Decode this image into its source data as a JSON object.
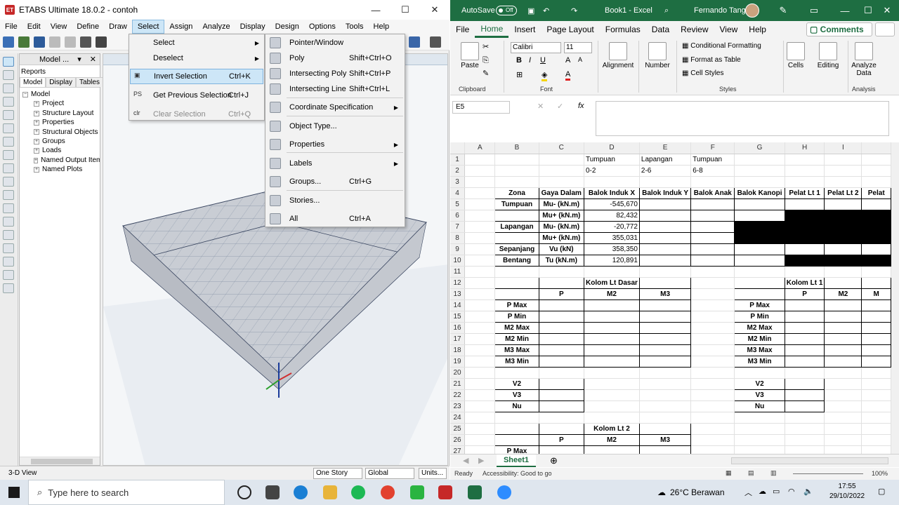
{
  "etabs": {
    "title": "ETABS Ultimate 18.0.2 - contoh",
    "app_badge": "ET",
    "menus": [
      "File",
      "Edit",
      "View",
      "Define",
      "Draw",
      "Select",
      "Assign",
      "Analyze",
      "Display",
      "Design",
      "Options",
      "Tools",
      "Help"
    ],
    "active_menu": "Select",
    "panel": {
      "title": "Model ...",
      "reports": "Reports",
      "tabs": [
        "Model",
        "Display",
        "Tables"
      ],
      "root": "Model",
      "items": [
        "Project",
        "Structure Layout",
        "Properties",
        "Structural Objects",
        "Groups",
        "Loads",
        "Named Output Items",
        "Named Plots"
      ]
    },
    "select_menu": [
      {
        "label": "Select",
        "shortcut": "",
        "submenu": true,
        "state": "normal",
        "icon": ""
      },
      {
        "label": "Deselect",
        "shortcut": "",
        "submenu": true,
        "state": "normal",
        "icon": ""
      },
      {
        "label": "Invert Selection",
        "shortcut": "Ctrl+K",
        "submenu": false,
        "state": "highlight",
        "icon": "invert-selection-icon"
      },
      {
        "label": "Get Previous Selection",
        "shortcut": "Ctrl+J",
        "submenu": false,
        "state": "normal",
        "icon": "PS"
      },
      {
        "label": "Clear Selection",
        "shortcut": "Ctrl+Q",
        "submenu": false,
        "state": "disabled",
        "icon": "clr"
      }
    ],
    "sub_menu": [
      {
        "label": "Pointer/Window",
        "shortcut": "",
        "submenu": false
      },
      {
        "label": "Poly",
        "shortcut": "Shift+Ctrl+O",
        "submenu": false
      },
      {
        "label": "Intersecting Poly",
        "shortcut": "Shift+Ctrl+P",
        "submenu": false
      },
      {
        "label": "Intersecting Line",
        "shortcut": "Shift+Ctrl+L",
        "submenu": false
      },
      {
        "label": "Coordinate Specification",
        "shortcut": "",
        "submenu": true
      },
      {
        "label": "Object Type...",
        "shortcut": "",
        "submenu": false
      },
      {
        "label": "Properties",
        "shortcut": "",
        "submenu": true
      },
      {
        "label": "Labels",
        "shortcut": "",
        "submenu": true
      },
      {
        "label": "Groups...",
        "shortcut": "Ctrl+G",
        "submenu": false
      },
      {
        "label": "Stories...",
        "shortcut": "",
        "submenu": false
      },
      {
        "label": "All",
        "shortcut": "Ctrl+A",
        "submenu": false
      }
    ],
    "status": {
      "view": "3-D View",
      "story": "One Story",
      "coord": "Global",
      "units": "Units..."
    }
  },
  "excel": {
    "autosave": "AutoSave",
    "autosave_state": "Off",
    "title": "Book1 - Excel",
    "user": "Fernando Tang",
    "tabs": [
      "File",
      "Home",
      "Insert",
      "Page Layout",
      "Formulas",
      "Data",
      "Review",
      "View",
      "Help"
    ],
    "active_tab": "Home",
    "comments": "Comments",
    "ribbon": {
      "paste": "Paste",
      "clipboard": "Clipboard",
      "font_name": "Calibri",
      "font_size": "11",
      "font": "Font",
      "alignment": "Alignment",
      "number": "Number",
      "cond_format": "Conditional Formatting",
      "format_table": "Format as Table",
      "cell_styles": "Cell Styles",
      "styles": "Styles",
      "cells": "Cells",
      "editing": "Editing",
      "analyze": "Analyze Data",
      "analysis": "Analysis"
    },
    "name_box": "E5",
    "fx": "fx",
    "columns": [
      "A",
      "B",
      "C",
      "D",
      "E",
      "F",
      "G",
      "H",
      "I",
      ""
    ],
    "rows": [
      [
        "",
        "",
        "",
        "Tumpuan",
        "Lapangan",
        "Tumpuan",
        "",
        "",
        "",
        ""
      ],
      [
        "",
        "",
        "",
        "0-2",
        "2-6",
        "6-8",
        "",
        "",
        "",
        ""
      ],
      [
        "",
        "",
        "",
        "",
        "",
        "",
        "",
        "",
        "",
        ""
      ],
      [
        "",
        "Zona",
        "Gaya Dalam",
        "Balok Induk X",
        "Balok Induk Y",
        "Balok Anak",
        "Balok Kanopi",
        "Pelat Lt 1",
        "Pelat Lt 2",
        "Pelat"
      ],
      [
        "",
        "Tumpuan",
        "Mu- (kN.m)",
        "-545,670",
        "",
        "",
        "",
        "",
        "",
        ""
      ],
      [
        "",
        "",
        "Mu+ (kN.m)",
        "82,432",
        "",
        "",
        "",
        "",
        "",
        ""
      ],
      [
        "",
        "Lapangan",
        "Mu- (kN.m)",
        "-20,772",
        "",
        "",
        "",
        "",
        "",
        ""
      ],
      [
        "",
        "",
        "Mu+ (kN.m)",
        "355,031",
        "",
        "",
        "",
        "",
        "",
        ""
      ],
      [
        "",
        "Sepanjang",
        "Vu (kN)",
        "358,350",
        "",
        "",
        "",
        "",
        "",
        ""
      ],
      [
        "",
        "Bentang",
        "Tu (kN.m)",
        "120,891",
        "",
        "",
        "",
        "",
        "",
        ""
      ],
      [
        "",
        "",
        "",
        "",
        "",
        "",
        "",
        "",
        "",
        ""
      ],
      [
        "",
        "",
        "",
        "Kolom Lt Dasar",
        "",
        "",
        "",
        "Kolom Lt 1",
        "",
        ""
      ],
      [
        "",
        "",
        "P",
        "M2",
        "M3",
        "",
        "",
        "P",
        "M2",
        "M"
      ],
      [
        "",
        "P Max",
        "",
        "",
        "",
        "",
        "P Max",
        "",
        "",
        ""
      ],
      [
        "",
        "P Min",
        "",
        "",
        "",
        "",
        "P Min",
        "",
        "",
        ""
      ],
      [
        "",
        "M2 Max",
        "",
        "",
        "",
        "",
        "M2 Max",
        "",
        "",
        ""
      ],
      [
        "",
        "M2 Min",
        "",
        "",
        "",
        "",
        "M2 Min",
        "",
        "",
        ""
      ],
      [
        "",
        "M3 Max",
        "",
        "",
        "",
        "",
        "M3 Max",
        "",
        "",
        ""
      ],
      [
        "",
        "M3 Min",
        "",
        "",
        "",
        "",
        "M3 Min",
        "",
        "",
        ""
      ],
      [
        "",
        "",
        "",
        "",
        "",
        "",
        "",
        "",
        "",
        ""
      ],
      [
        "",
        "V2",
        "",
        "",
        "",
        "",
        "V2",
        "",
        "",
        ""
      ],
      [
        "",
        "V3",
        "",
        "",
        "",
        "",
        "V3",
        "",
        "",
        ""
      ],
      [
        "",
        "Nu",
        "",
        "",
        "",
        "",
        "Nu",
        "",
        "",
        ""
      ],
      [
        "",
        "",
        "",
        "",
        "",
        "",
        "",
        "",
        "",
        ""
      ],
      [
        "",
        "",
        "",
        "Kolom Lt 2",
        "",
        "",
        "",
        "",
        "",
        ""
      ],
      [
        "",
        "",
        "P",
        "M2",
        "M3",
        "",
        "",
        "",
        "",
        ""
      ],
      [
        "",
        "P Max",
        "",
        "",
        "",
        "",
        "",
        "",
        "",
        ""
      ]
    ],
    "sheet": "Sheet1",
    "status_ready": "Ready",
    "accessibility": "Accessibility: Good to go",
    "zoom": "100%"
  },
  "taskbar": {
    "search_placeholder": "Type here to search",
    "weather": "26°C  Berawan",
    "time": "17:55",
    "date": "29/10/2022"
  }
}
